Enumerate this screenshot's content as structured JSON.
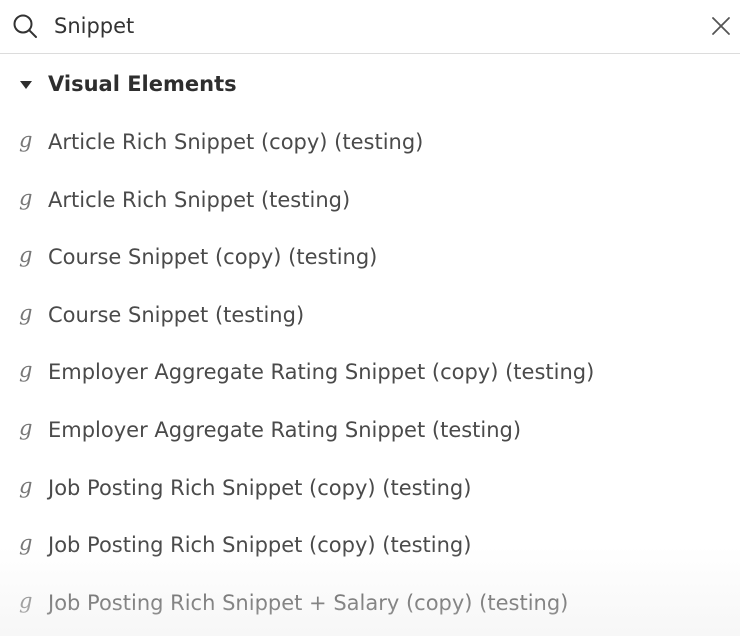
{
  "search": {
    "value": "Snippet",
    "icon": "search-icon",
    "clear_icon": "close-icon"
  },
  "group": {
    "title": "Visual Elements",
    "icon": "caret-down-icon",
    "expanded": true
  },
  "items": [
    {
      "label": "Article Rich Snippet (copy) (testing)",
      "icon": "tag-icon"
    },
    {
      "label": "Article Rich Snippet (testing)",
      "icon": "tag-icon"
    },
    {
      "label": "Course Snippet (copy) (testing)",
      "icon": "tag-icon"
    },
    {
      "label": "Course Snippet (testing)",
      "icon": "tag-icon"
    },
    {
      "label": "Employer Aggregate Rating Snippet (copy) (testing)",
      "icon": "tag-icon"
    },
    {
      "label": "Employer Aggregate Rating Snippet (testing)",
      "icon": "tag-icon"
    },
    {
      "label": "Job Posting Rich Snippet (copy) (testing)",
      "icon": "tag-icon"
    },
    {
      "label": "Job Posting Rich Snippet (copy) (testing)",
      "icon": "tag-icon"
    },
    {
      "label": "Job Posting Rich Snippet + Salary (copy) (testing)",
      "icon": "tag-icon"
    }
  ],
  "colors": {
    "text": "#4a4a4a",
    "heading": "#2e2e2e",
    "icon": "#777777",
    "divider": "#dcdcdc"
  }
}
